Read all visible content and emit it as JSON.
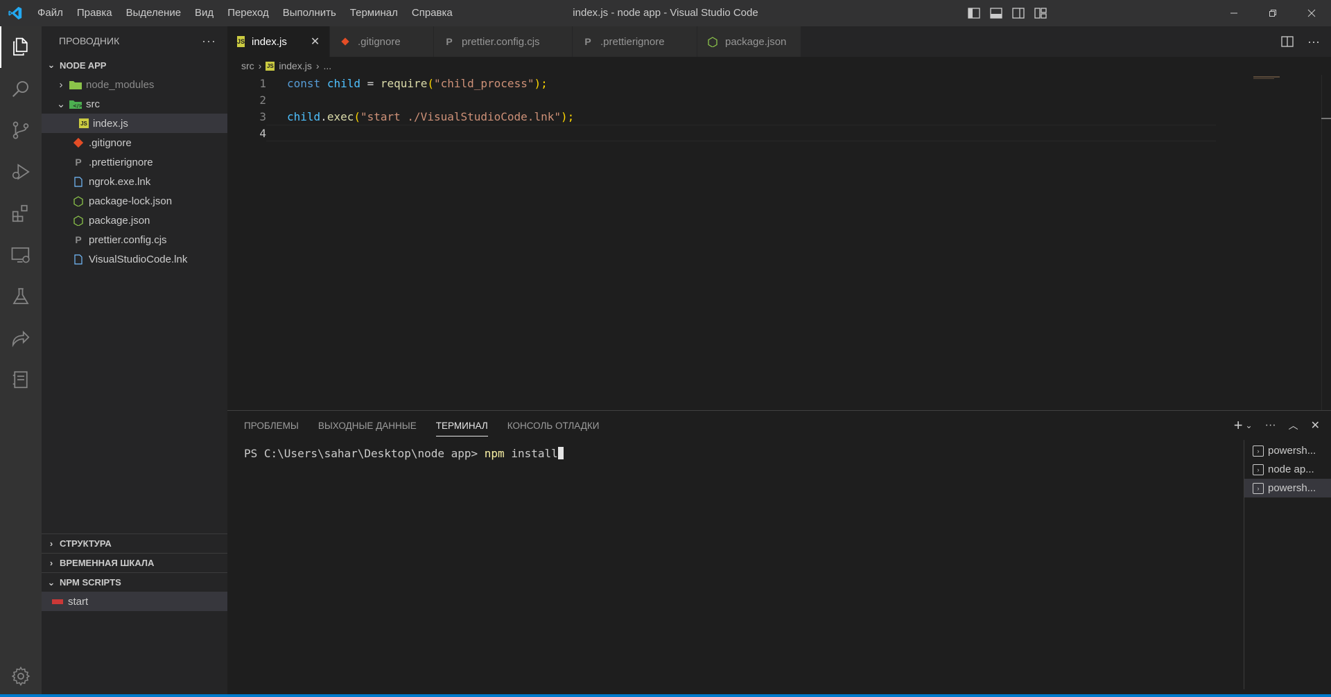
{
  "window": {
    "title": "index.js - node app - Visual Studio Code",
    "menu": [
      "Файл",
      "Правка",
      "Выделение",
      "Вид",
      "Переход",
      "Выполнить",
      "Терминал",
      "Справка"
    ]
  },
  "sidebar": {
    "header": "ПРОВОДНИК",
    "more": "···",
    "project": "NODE APP",
    "tree": {
      "node_modules": "node_modules",
      "src": "src",
      "index": "index.js",
      "gitignore": ".gitignore",
      "prettierignore": ".prettierignore",
      "ngrok": "ngrok.exe.lnk",
      "package_lock": "package-lock.json",
      "package": "package.json",
      "prettier_config": "prettier.config.cjs",
      "vscode_lnk": "VisualStudioCode.lnk"
    },
    "sections": {
      "structure": "СТРУКТУРА",
      "timeline": "ВРЕМЕННАЯ ШКАЛА",
      "npm_scripts": "NPM SCRIPTS"
    },
    "npm_start": "start"
  },
  "tabs": [
    {
      "label": "index.js",
      "icon": "js-icon",
      "color": "#cbcb41"
    },
    {
      "label": ".gitignore",
      "icon": "git-icon",
      "color": "#e44d26"
    },
    {
      "label": "prettier.config.cjs",
      "icon": "prettier-icon",
      "color": "#8c8c8c"
    },
    {
      "label": ".prettierignore",
      "icon": "prettier-icon",
      "color": "#8c8c8c"
    },
    {
      "label": "package.json",
      "icon": "npm-icon",
      "color": "#8bc34a"
    }
  ],
  "breadcrumb": {
    "folder": "src",
    "file": "index.js",
    "more": "..."
  },
  "code": {
    "line_numbers": [
      "1",
      "2",
      "3",
      "4"
    ],
    "line1": {
      "kw": "const",
      "var": "child",
      "eq": " = ",
      "fn": "require",
      "open": "(",
      "str": "\"child_process\"",
      "close": ");"
    },
    "line3": {
      "obj": "child",
      "dot": ".",
      "fn": "exec",
      "open": "(",
      "str": "\"start ./VisualStudioCode.lnk\"",
      "close": ");"
    }
  },
  "panel": {
    "tabs": {
      "problems": "ПРОБЛЕМЫ",
      "output": "ВЫХОДНЫЕ ДАННЫЕ",
      "terminal": "ТЕРМИНАЛ",
      "debug": "КОНСОЛЬ ОТЛАДКИ"
    },
    "terminal": {
      "prompt": "PS C:\\Users\\sahar\\Desktop\\node app> ",
      "cmd": "npm",
      "args": " install"
    },
    "terminal_list": [
      "powersh...",
      "node ap...",
      "powersh..."
    ]
  },
  "colors": {
    "accent": "#007acc",
    "titlebar": "#323233",
    "activitybar": "#333333",
    "sidebar": "#252526",
    "editor": "#1e1e1e"
  }
}
